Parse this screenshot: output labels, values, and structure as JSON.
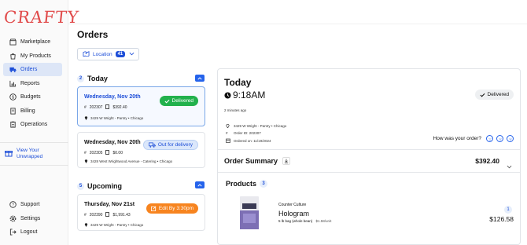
{
  "brand": {
    "logo_text": "CRAFTY",
    "accent": "#e14b4b",
    "primary": "#1d4ed8"
  },
  "sidebar": {
    "items": [
      {
        "label": "Marketplace",
        "icon": "store-icon",
        "active": false
      },
      {
        "label": "My Products",
        "icon": "products-icon",
        "active": false
      },
      {
        "label": "Orders",
        "icon": "truck-icon",
        "active": true
      },
      {
        "label": "Reports",
        "icon": "chart-icon",
        "active": false
      },
      {
        "label": "Budgets",
        "icon": "dollar-icon",
        "active": false
      },
      {
        "label": "Billing",
        "icon": "billing-icon",
        "active": false
      },
      {
        "label": "Operations",
        "icon": "clipboard-icon",
        "active": false
      }
    ],
    "view_unwrapped": "View Your Unwrapped",
    "bottom_items": [
      {
        "label": "Support",
        "icon": "help-icon"
      },
      {
        "label": "Settings",
        "icon": "gear-icon"
      },
      {
        "label": "Logout",
        "icon": "logout-icon"
      }
    ]
  },
  "main": {
    "title": "Orders",
    "location_filter": {
      "label": "Location",
      "count": "41"
    },
    "today": {
      "label": "Today",
      "count": "2",
      "orders": [
        {
          "date": "Wednesday, Nov 20th",
          "order_id": "202307",
          "amount": "$392.40",
          "address": "3429 W Wright - Pantry • Chicago",
          "status": "Delivered"
        },
        {
          "date": "Wednesday, Nov 20th",
          "order_id": "202305",
          "amount": "$0.00",
          "address": "3428 West Wrightwood Avenue - Catering • Chicago",
          "status": "Out for delivery"
        }
      ]
    },
    "upcoming": {
      "label": "Upcoming",
      "count": "5",
      "orders": [
        {
          "date": "Thursday, Nov 21st",
          "order_id": "202390",
          "amount": "$1,991.43",
          "address": "3429 W Wright - Pantry • Chicago",
          "status": "Edit By 3:30pm"
        }
      ]
    }
  },
  "detail": {
    "day": "Today",
    "time": "9:18AM",
    "status": "Delivered",
    "ago": "2 minutes ago",
    "address": "3429 W Wright - Pantry • Chicago",
    "order_id": "Order ID: 202307",
    "ordered_on": "Ordered on: 11/19/2024",
    "rating_prompt": "How was your order?",
    "summary_label": "Order Summary",
    "summary_total": "$392.40",
    "products_label": "Products",
    "products_count": "3",
    "product": {
      "brand": "Counter Culture",
      "name": "Hologram",
      "description": "5 lb bag (whole bean)",
      "unit_price": "$1.58/unit",
      "quantity": "1",
      "price": "$126.58",
      "package_label": "HOLOGRAM"
    }
  }
}
